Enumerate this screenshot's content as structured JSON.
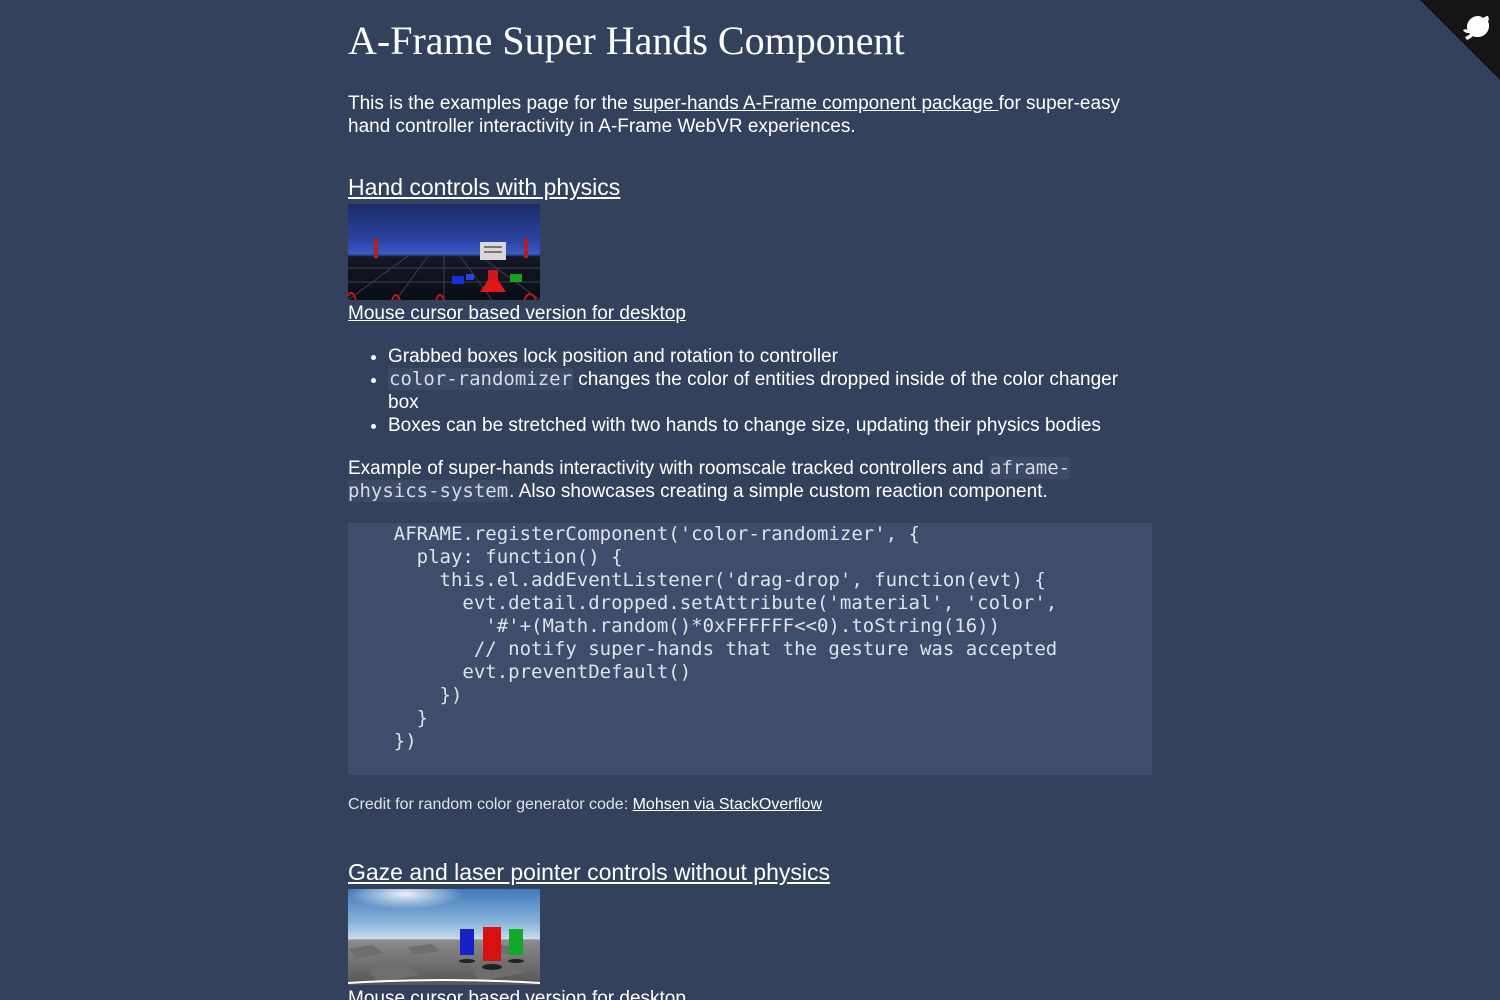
{
  "header": {
    "title": "A-Frame Super Hands Component"
  },
  "intro": {
    "before": "This is the examples page for the ",
    "link": "super-hands A-Frame component package ",
    "after": "for super-easy hand controller interactivity in A-Frame WebVR experiences."
  },
  "section1": {
    "heading": "Hand controls with physics",
    "desktop_link": "Mouse cursor based version for desktop",
    "bullets": {
      "b1": "Grabbed boxes lock position and rotation to controller",
      "b2_code": "color-randomizer",
      "b2_text": " changes the color of entities dropped inside of the color changer box",
      "b3": "Boxes can be stretched with two hands to change size, updating their physics bodies"
    },
    "example": {
      "before": "Example of super-hands interactivity with roomscale tracked controllers and ",
      "code": "aframe-physics-system",
      "after": ". Also showcases creating a simple custom reaction component."
    },
    "code_block": "    AFRAME.registerComponent('color-randomizer', {\n      play: function() {\n        this.el.addEventListener('drag-drop', function(evt) {\n          evt.detail.dropped.setAttribute('material', 'color',\n            '#'+(Math.random()*0xFFFFFF<<0).toString(16))\n           // notify super-hands that the gesture was accepted\n          evt.preventDefault()\n        })\n      }\n    })",
    "credit": {
      "label": "Credit for random color generator code: ",
      "link": "Mohsen via StackOverflow"
    }
  },
  "section2": {
    "heading": "Gaze and laser pointer controls without physics",
    "desktop_link": "Mouse cursor based version for desktop"
  },
  "icons": {
    "corner": "github-octocat-icon"
  }
}
